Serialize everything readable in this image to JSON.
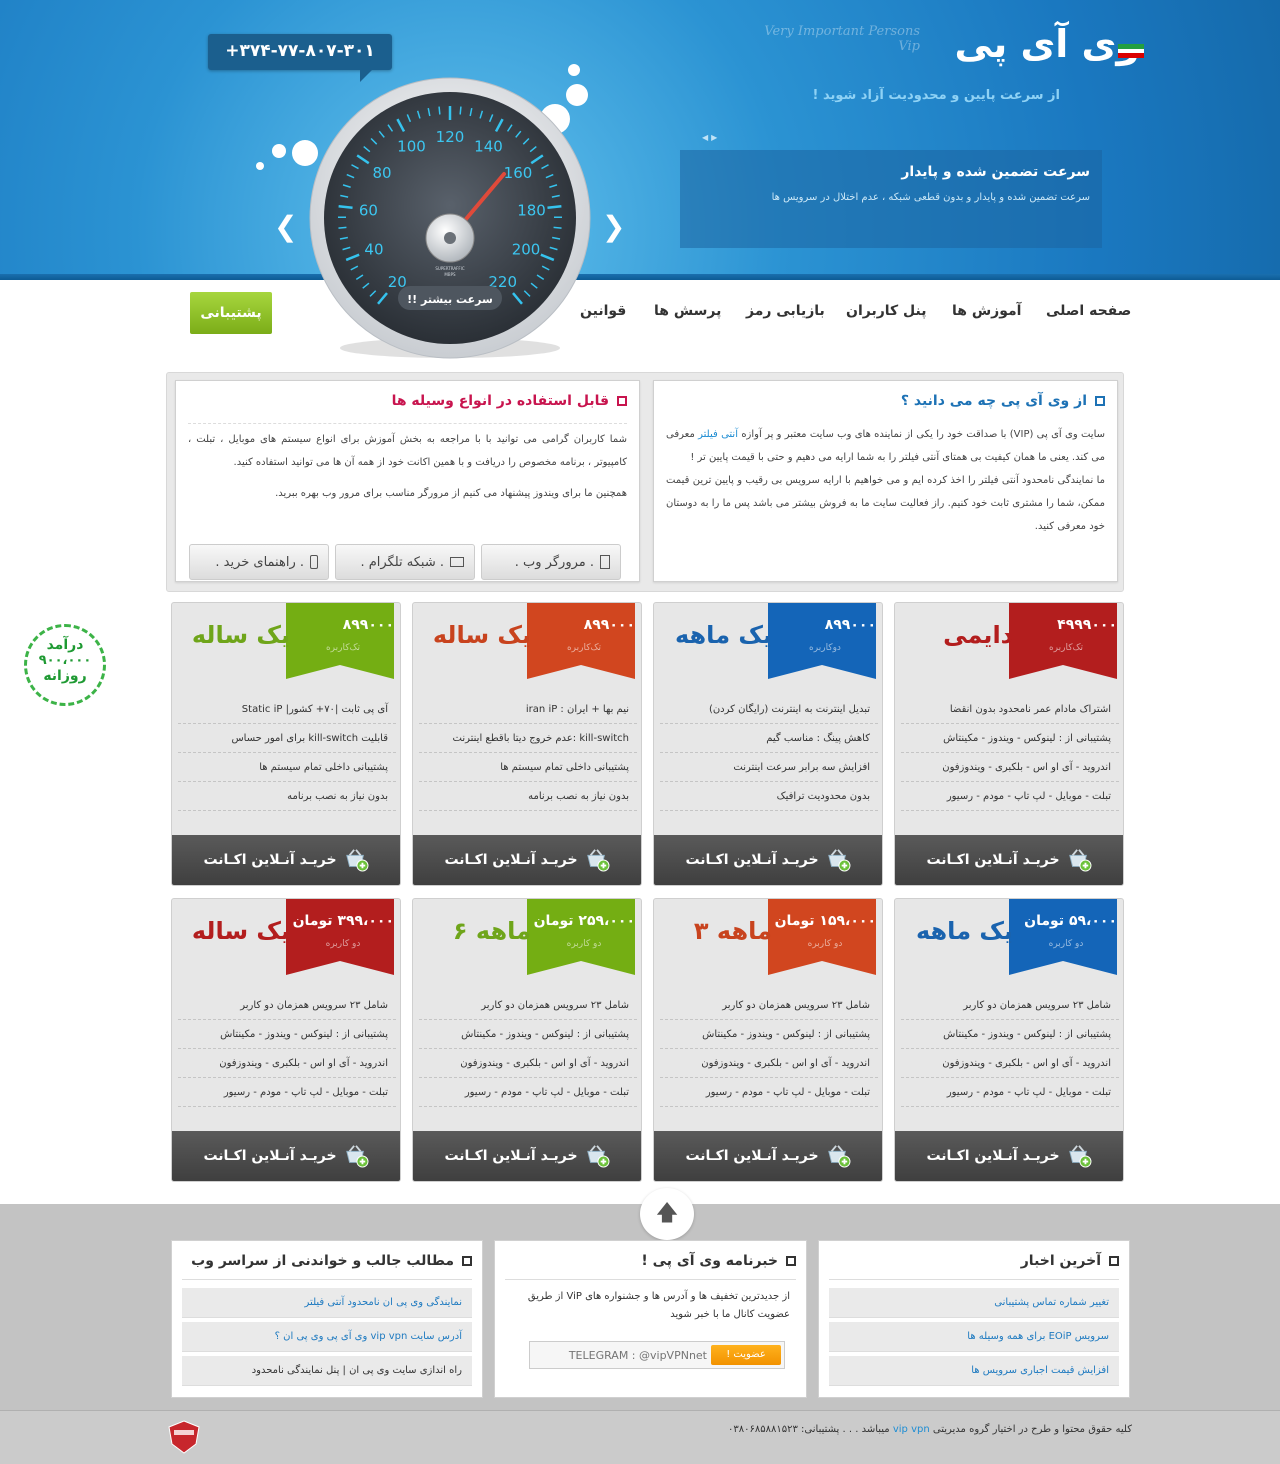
{
  "header": {
    "phone": "+۳۷۴-۷۷-۸۰۷-۳۰۱",
    "logo": "وی آی پی",
    "logo_sub": "Very Important Persons Vip",
    "slogan": "از سرعت پایین و محدودیت آزاد شوید !",
    "slide_title": "سرعت تضمین شده و پایدار",
    "slide_text": "سرعت تضمین شده و پایدار و بدون قطعی شبکه ، عدم اختلال در سرویس ها",
    "prev_icon": "chevron-left-icon",
    "next_icon": "chevron-right-icon",
    "gauge": {
      "labels": [
        "20",
        "40",
        "60",
        "80",
        "100",
        "120",
        "140",
        "160",
        "180",
        "200",
        "220"
      ],
      "caption": "سرعت بیشتر !!",
      "small_text": "SUPERTRAFFIC",
      "small_text2": "MBPS"
    }
  },
  "nav": {
    "items": [
      "صفحه اصلی",
      "آموزش ها",
      "پنل کاربران",
      "بازیابی رمز",
      "پرسش ها",
      "قوانین"
    ],
    "support": "پشتیبانی"
  },
  "info": {
    "left_title": "از وی آی پی چه می دانید ؟",
    "left_p1_a": "سایت وی آی پی (VIP) با صداقت خود را یکی از نماینده های وب سایت معتبر و پر آوازه",
    "left_p1_link": "آنتی فیلتر",
    "left_p1_b": "معرفی می کند. یعنی ما همان کیفیت بی همتای آنتی فیلتر را به شما ارایه می دهیم و حتی با قیمت پایین تر !",
    "left_p2": "ما نمایندگی نامحدود آنتی فیلتر را اخذ کرده ایم و می خواهیم با ارایه سرویس بی رقیب و پایین ترین قیمت ممکن، شما را مشتری ثابت خود کنیم. راز فعالیت سایت ما به فروش بیشتر می باشد پس ما را به دوستان خود معرفی کنید.",
    "right_title": "قابل استفاده در انواع وسیله ها",
    "right_p1": "شما کاربران گرامی می توانید با با مراجعه به بخش آموزش برای انواع سیستم های موبایل ، تبلت ، کامپیوتر ، برنامه مخصوص را دریافت و با همین اکانت خود از همه آن ها می توانید استفاده کنید.",
    "right_p2": "همچنین ما برای ویندوز پیشنهاد می کنیم از مرورگر مناسب برای مرور وب بهره ببرید.",
    "tabs": [
      {
        "label": ". مرورگر وب .",
        "icon": "battery-icon"
      },
      {
        "label": ". شبکه تلگرام .",
        "icon": "monitor-icon"
      },
      {
        "label": ". راهنمای خرید .",
        "icon": "mobile-icon"
      }
    ]
  },
  "income": {
    "line1": "درآمد",
    "line2": "۹۰۰،۰۰۰",
    "line3": "روزانه"
  },
  "pricing_row1": [
    {
      "title": "دایمی",
      "price": "۴۹۹۹۰۰۰",
      "type": "تک‌کاربره",
      "ribbon": "#b31e1e",
      "title_color": "#b31e1e",
      "features": [
        "اشتراک مادام عمر نامحدود بدون انقضا",
        "پشتیبانی از : لینوکس - ویندوز - مکینتاش",
        "اندروید - آی او اس - بلکبری - ویندوزفون",
        "تبلت - موبایل - لپ تاپ - مودم - رسیور"
      ]
    },
    {
      "title": "یک ماهه",
      "price": "۸۹۹۰۰۰",
      "type": "دوکاربره",
      "ribbon": "#1465b8",
      "title_color": "#1a63ae",
      "features": [
        "تبدیل اینترنت به اینترنت (رایگان کردن)",
        "کاهش پینگ : مناسب گیم",
        "افزایش سه برابر سرعت اینترنت",
        "بدون محدودیت ترافیک"
      ]
    },
    {
      "title": "یک ساله",
      "price": "۸۹۹۰۰۰",
      "type": "تک‌کاربره",
      "ribbon": "#d1461f",
      "title_color": "#c8431e",
      "features": [
        "نیم بها + ایران : iran iP",
        "kill-switch :عدم خروج دیتا باقطع اینترنت",
        "پشتیبانی داخلی تمام سیستم ها",
        "بدون نیاز به نصب برنامه"
      ]
    },
    {
      "title": "یک ساله",
      "price": "۸۹۹۰۰۰",
      "type": "تک‌کاربره",
      "ribbon": "#74ae13",
      "title_color": "#6fa51a",
      "features": [
        "آی پی ثابت |۷۰+ کشور| Static iP",
        "قابلیت kill-switch برای امور حساس",
        "پشتیبانی داخلی تمام سیستم ها",
        "بدون نیاز به نصب برنامه"
      ]
    }
  ],
  "pricing_row2": [
    {
      "title": "یک ماهه",
      "price": "۵۹،۰۰۰ تومان",
      "type": "دو کاربره",
      "ribbon": "#1465b8",
      "title_color": "#1a63ae",
      "features": [
        "شامل ۲۳ سرویس همزمان دو کاربر",
        "پشتیبانی از : لینوکس - ویندوز - مکینتاش",
        "اندروید - آی او اس - بلکبری - ویندوزفون",
        "تبلت - موبایل - لپ تاپ - مودم - رسیور"
      ]
    },
    {
      "title": "۳ ماهه",
      "price": "۱۵۹،۰۰۰ تومان",
      "type": "دو کاربره",
      "ribbon": "#d1461f",
      "title_color": "#c8431e",
      "features": [
        "شامل ۲۳ سرویس همزمان دو کاربر",
        "پشتیبانی از : لینوکس - ویندوز - مکینتاش",
        "اندروید - آی او اس - بلکبری - ویندوزفون",
        "تبلت - موبایل - لپ تاپ - مودم - رسیور"
      ]
    },
    {
      "title": "۶ ماهه",
      "price": "۲۵۹،۰۰۰ تومان",
      "type": "دو کاربره",
      "ribbon": "#74ae13",
      "title_color": "#6fa51a",
      "features": [
        "شامل ۲۳ سرویس همزمان دو کاربر",
        "پشتیبانی از : لینوکس - ویندوز - مکینتاش",
        "اندروید - آی او اس - بلکبری - ویندوزفون",
        "تبلت - موبایل - لپ تاپ - مودم - رسیور"
      ]
    },
    {
      "title": "یک ساله",
      "price": "۳۹۹،۰۰۰ تومان",
      "type": "دو کاربره",
      "ribbon": "#b31e1e",
      "title_color": "#b31e1e",
      "features": [
        "شامل ۲۳ سرویس همزمان دو کاربر",
        "پشتیبانی از : لینوکس - ویندوز - مکینتاش",
        "اندروید - آی او اس - بلکبری - ویندوزفون",
        "تبلت - موبایل - لپ تاپ - مودم - رسیور"
      ]
    }
  ],
  "buy_label": "خریـد آنـلاین اکـانت",
  "footer": {
    "news_title": "آخرین اخبار",
    "news": [
      "تغییر شماره تماس پشتیبانی",
      "سرویس EOiP برای همه وسیله ها",
      "افزایش قیمت اجباری سرویس ها"
    ],
    "newsletter_title": "خبرنامه وی آی پی !",
    "newsletter_text": "از جدیدترین تخفیف ها و آدرس ها و جشنواره های ViP از طریق عضویت کانال ما با خبر شوید",
    "telegram_placeholder": "TELEGRAM : @vipVPNnet",
    "subscribe": "عضویت !",
    "articles_title": "مطالب جالب و خواندنی از سراسر وب",
    "articles": [
      "نمایندگی وی پی ان نامحدود آنتی فیلتر",
      "آدرس سایت vip vpn وی آی پی وی پی ان ؟",
      "راه اندازی سایت وی پی ان | پنل نمایندگی نامحدود"
    ],
    "copyright_a": "کلیه حقوق محتوا و طرح در اختیار گروه مدیریتی",
    "copyright_link": "vip vpn",
    "copyright_b": "میباشد . . . پشتیبانی: ۰۳۸۰۶۸۵۸۸۱۵۲۳",
    "totop_icon": "arrow-up-icon"
  }
}
